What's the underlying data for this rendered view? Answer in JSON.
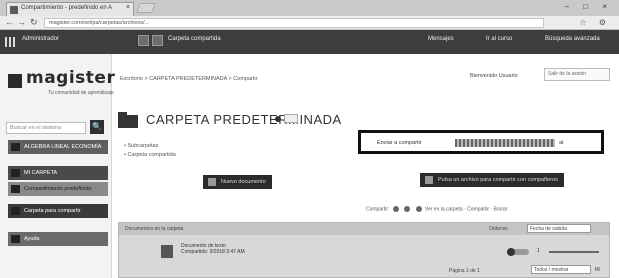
{
  "browser": {
    "tab_title": "Compartimiento - predefinido en A",
    "tab_close": "×",
    "url": "magister.com/net/pa/carpetas/archivos/...",
    "nav_back": "←",
    "nav_forward": "→",
    "nav_reload": "↻",
    "address_icons": "☆ ⚙",
    "window_controls": "– □ ×"
  },
  "topbar": {
    "items": [
      "Administrador",
      "Carpeta compartida",
      "Mensajes",
      "Ir al curso",
      "Búsqueda avanzada"
    ]
  },
  "sidebar": {
    "logo_text": "magister",
    "logo_subtitle": "Tu comunidad de aprendizaje",
    "search_placeholder": "Buscar en el sistema",
    "search_button": "🔍",
    "items": [
      "ALGEBRA LINEAL ECONOMÍA",
      "MI CARPETA",
      "Compartimiento predefinido",
      "Carpeta para compartir",
      "Ayuda"
    ]
  },
  "main": {
    "breadcrumb": "Escritorio > CARPETA PREDETERMINADA > Compartir",
    "user_label": "Bienvenido Usuario",
    "user_button": "Salir de la sesión",
    "folder_title": "CARPETA PREDETERMINADA",
    "bullets": [
      "Subcarpetas",
      "Carpeta compartida"
    ],
    "new_doc_button": "Nuevo documento",
    "info_label": "Enviar a compartir",
    "info_tail": "al",
    "send_button": "Pulsa un archivo para compartir con compañeros"
  },
  "share": {
    "label": "Compartir:",
    "actions": "Ver en la carpeta · Compartir · Borrar"
  },
  "listing": {
    "header": "Documentos en la carpeta",
    "sort_label": "Ordenar:",
    "sort_value": "Fecha de subida",
    "file_name_line1": "Documento de texto",
    "file_name_line2": "Compartido: 9/2018 9:47 AM",
    "file_count": "1",
    "pager": "Página 1 de 1",
    "per_page": "Todos / mostrar",
    "per_page_go": "IR"
  }
}
